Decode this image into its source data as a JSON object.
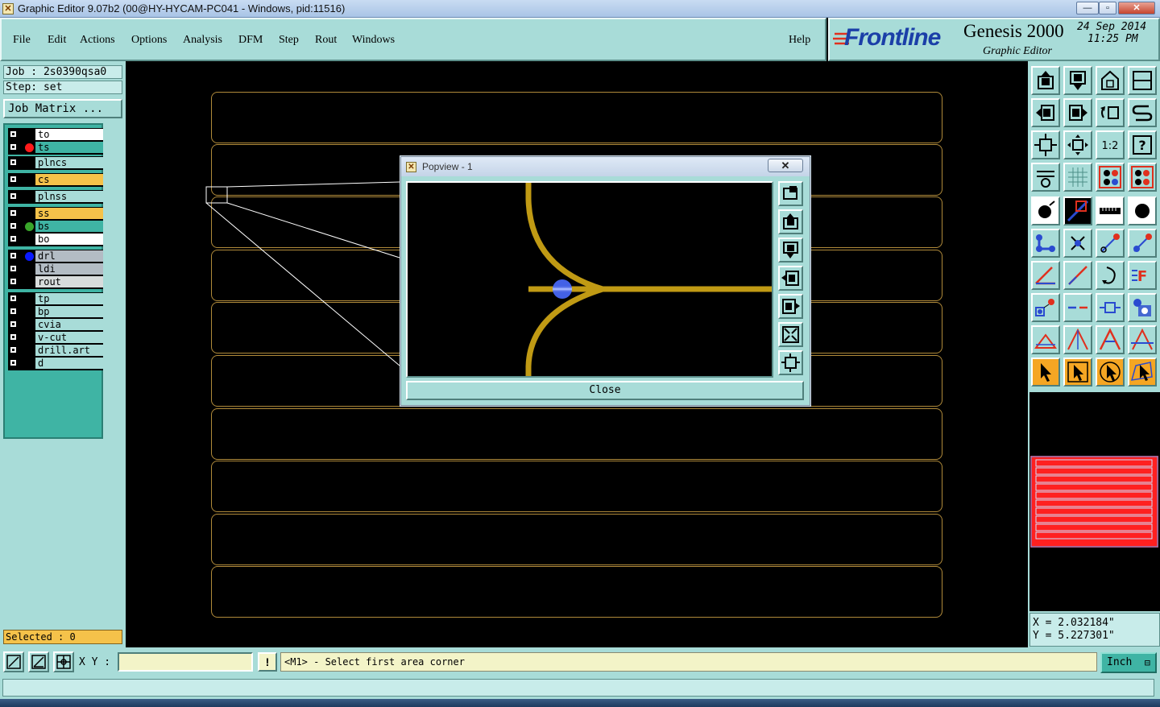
{
  "window": {
    "title": "Graphic Editor 9.07b2 (00@HY-HYCAM-PC041 - Windows, pid:11516)"
  },
  "menu": [
    "File",
    "Edit",
    "Actions",
    "Options",
    "Analysis",
    "DFM",
    "Step",
    "Rout",
    "Windows"
  ],
  "help": "Help",
  "brand": {
    "name": "Frontline",
    "product": "Genesis 2000",
    "subtitle": "Graphic Editor",
    "date": "24 Sep 2014",
    "time": "11:25 PM"
  },
  "job": {
    "job_label": "Job : 2s0390qsa0",
    "step_label": "Step: set",
    "matrix_label": "Job Matrix ..."
  },
  "layers": [
    {
      "name": "to",
      "bg": "#ffffff",
      "dot": ""
    },
    {
      "name": "ts",
      "bg": "#3fb4a4",
      "dot": "#ff1a1a"
    },
    {
      "name": "plncs",
      "bg": "#a8dcd8",
      "dot": ""
    },
    {
      "name": "cs",
      "bg": "#f5c24a",
      "dot": ""
    },
    {
      "name": "plnss",
      "bg": "#a8dcd8",
      "dot": ""
    },
    {
      "name": "ss",
      "bg": "#f5c24a",
      "dot": ""
    },
    {
      "name": "bs",
      "bg": "#3fb4a4",
      "dot": "#39a52a"
    },
    {
      "name": "bo",
      "bg": "#ffffff",
      "dot": ""
    },
    {
      "name": "drl",
      "bg": "#b3bcc4",
      "dot": "#0a1aff"
    },
    {
      "name": "ldi",
      "bg": "#b3bcc4",
      "dot": ""
    },
    {
      "name": "rout",
      "bg": "#d8dcdc",
      "dot": ""
    },
    {
      "name": "tp",
      "bg": "#a8dcd8",
      "dot": ""
    },
    {
      "name": "bp",
      "bg": "#a8dcd8",
      "dot": ""
    },
    {
      "name": "cvia",
      "bg": "#a8dcd8",
      "dot": ""
    },
    {
      "name": "v-cut",
      "bg": "#a8dcd8",
      "dot": ""
    },
    {
      "name": "drill.art",
      "bg": "#a8dcd8",
      "dot": ""
    },
    {
      "name": "d",
      "bg": "#a8dcd8",
      "dot": ""
    }
  ],
  "selected": "Selected : 0",
  "popview": {
    "title": "Popview - 1",
    "close_label": "Close"
  },
  "coords": {
    "x": "X = 2.032184\"",
    "y": "Y = 5.227301\""
  },
  "bottom": {
    "xy_label": "X Y :",
    "xy_value": "",
    "warn": "!",
    "message": "<M1> - Select first area corner",
    "unit": "Inch"
  },
  "colors": {
    "panel_bg": "#a8dcd8",
    "trace": "#c09a14",
    "outline": "#b08a3a",
    "pad": "#4a6cff"
  }
}
